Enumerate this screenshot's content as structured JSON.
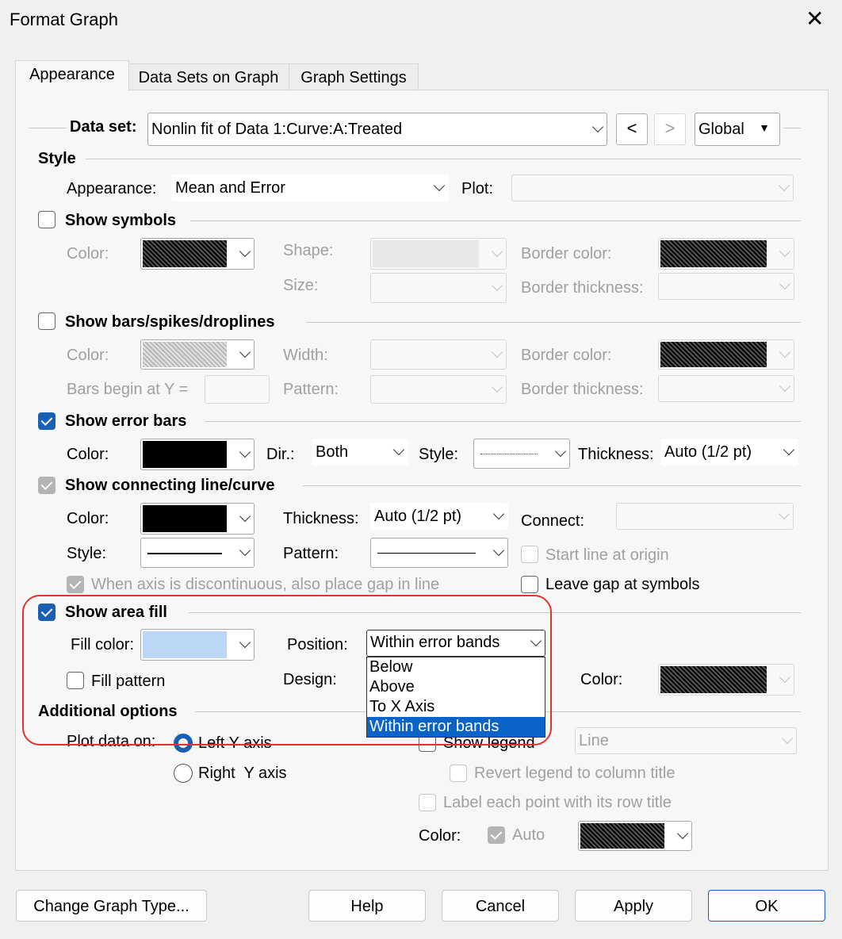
{
  "window": {
    "title": "Format Graph"
  },
  "tabs": [
    "Appearance",
    "Data Sets on Graph",
    "Graph Settings"
  ],
  "dataset": {
    "label": "Data set:",
    "value": "Nonlin fit of Data 1:Curve:A:Treated",
    "prev": "<",
    "next": ">",
    "scope": "Global"
  },
  "style": {
    "heading": "Style",
    "appearance_label": "Appearance:",
    "appearance_value": "Mean and Error",
    "plot_label": "Plot:"
  },
  "symbols": {
    "heading": "Show symbols",
    "checked": false,
    "color_label": "Color:",
    "shape_label": "Shape:",
    "size_label": "Size:",
    "border_color_label": "Border color:",
    "border_thickness_label": "Border thickness:"
  },
  "bars": {
    "heading": "Show bars/spikes/droplines",
    "checked": false,
    "color_label": "Color:",
    "width_label": "Width:",
    "begin_label": "Bars begin at Y =",
    "pattern_label": "Pattern:",
    "border_color_label": "Border color:",
    "border_thickness_label": "Border thickness:"
  },
  "error_bars": {
    "heading": "Show error bars",
    "checked": true,
    "color_label": "Color:",
    "dir_label": "Dir.:",
    "dir_value": "Both",
    "style_label": "Style:",
    "thickness_label": "Thickness:",
    "thickness_value": "Auto (1/2 pt)"
  },
  "connecting": {
    "heading": "Show connecting line/curve",
    "checked": true,
    "color_label": "Color:",
    "thickness_label": "Thickness:",
    "thickness_value": "Auto (1/2 pt)",
    "connect_label": "Connect:",
    "style_label": "Style:",
    "pattern_label": "Pattern:",
    "start_origin": "Start line at origin",
    "gap_discontinuous": "When axis is discontinuous, also place gap in line",
    "leave_gap": "Leave gap at symbols"
  },
  "area_fill": {
    "heading": "Show area fill",
    "checked": true,
    "fill_color_label": "Fill color:",
    "position_label": "Position:",
    "position_value": "Within error bands",
    "fill_pattern": "Fill pattern",
    "design_label": "Design:",
    "color_label": "Color:",
    "fill_color_hex": "#bcd7f6"
  },
  "position_dropdown": {
    "options": [
      "Below",
      "Above",
      "To X Axis",
      "Within error bands"
    ],
    "selected": "Within error bands"
  },
  "additional": {
    "heading": "Additional options",
    "plot_on_label": "Plot data on:",
    "left_axis": "Left Y axis",
    "right_axis": "Right  Y axis",
    "show_legend": "Show legend",
    "legend_value": "Line",
    "revert_legend": "Revert legend to column title",
    "label_each": "Label each point with its row title",
    "color_label": "Color:",
    "auto_label": "Auto"
  },
  "buttons": {
    "change_type": "Change Graph Type...",
    "help": "Help",
    "cancel": "Cancel",
    "apply": "Apply",
    "ok": "OK"
  },
  "colors": {
    "accent": "#1a5fb4",
    "highlight_ring": "#e0332c",
    "selected_option": "#0a64c8"
  }
}
